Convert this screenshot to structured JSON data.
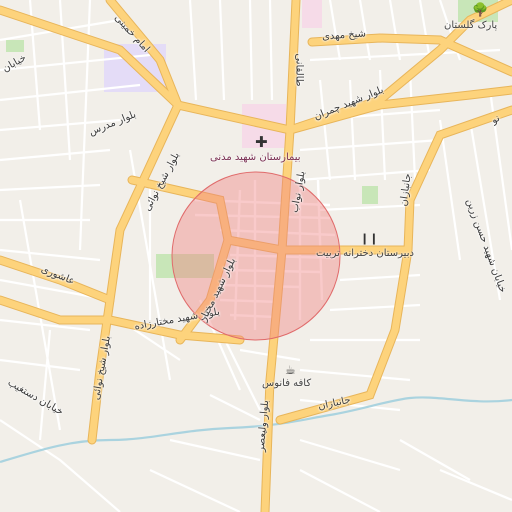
{
  "map": {
    "streets": {
      "imam_khomeini": "امام خمینی",
      "modarres": "بلوار مدرس",
      "sheikh_mahdi": "شیخ مهدی",
      "taleghani": "طالقانی",
      "shahid_chamran": "بلوار شهید چمران",
      "nawab": "بلوار نواب",
      "sheikh_nawai": "بلوار شیخ نوائی",
      "valiasr_top": "بلوار ولیعصر",
      "valiasr_bottom": "بلوار ولیعصر",
      "khayaban_left": "خیابان",
      "ashouri": "عاشوری",
      "shahid_mokhtarzadeh": "بلوار شهید مختارزاده",
      "shahid_mokhtar_diag": "بلوار شهید مختار",
      "sheikh_nawai_lower": "بلوار شیخ نوائی",
      "khayaban_dastghaib": "خیابان دستغیب",
      "janbazan_right": "جانبازان",
      "janbazan_bottom": "جانبازان",
      "shahid_hasan_zarrin": "خیابان شهید حسن زرین",
      "nou": "نو"
    },
    "pois": {
      "park": "پارک گلستان",
      "hospital": "بیمارستان شهید مدنی",
      "school": "دبیرستان دخترانه تربیت",
      "cafe": "کافه فانوس"
    },
    "icons": {
      "park": "tree-icon",
      "hospital": "hospital-cross-icon",
      "school": "school-icon",
      "cafe": "cafe-icon"
    },
    "colors": {
      "background": "#f2efe9",
      "major_road": "#fdd37c",
      "major_road_casing": "#e8b55a",
      "minor_road": "#ffffff",
      "water": "#aad3df",
      "park": "#c8e6b8",
      "hospital_area": "#f6dbe8",
      "school_area": "#e4dcf7",
      "highlight_circle": "#f08080"
    }
  }
}
